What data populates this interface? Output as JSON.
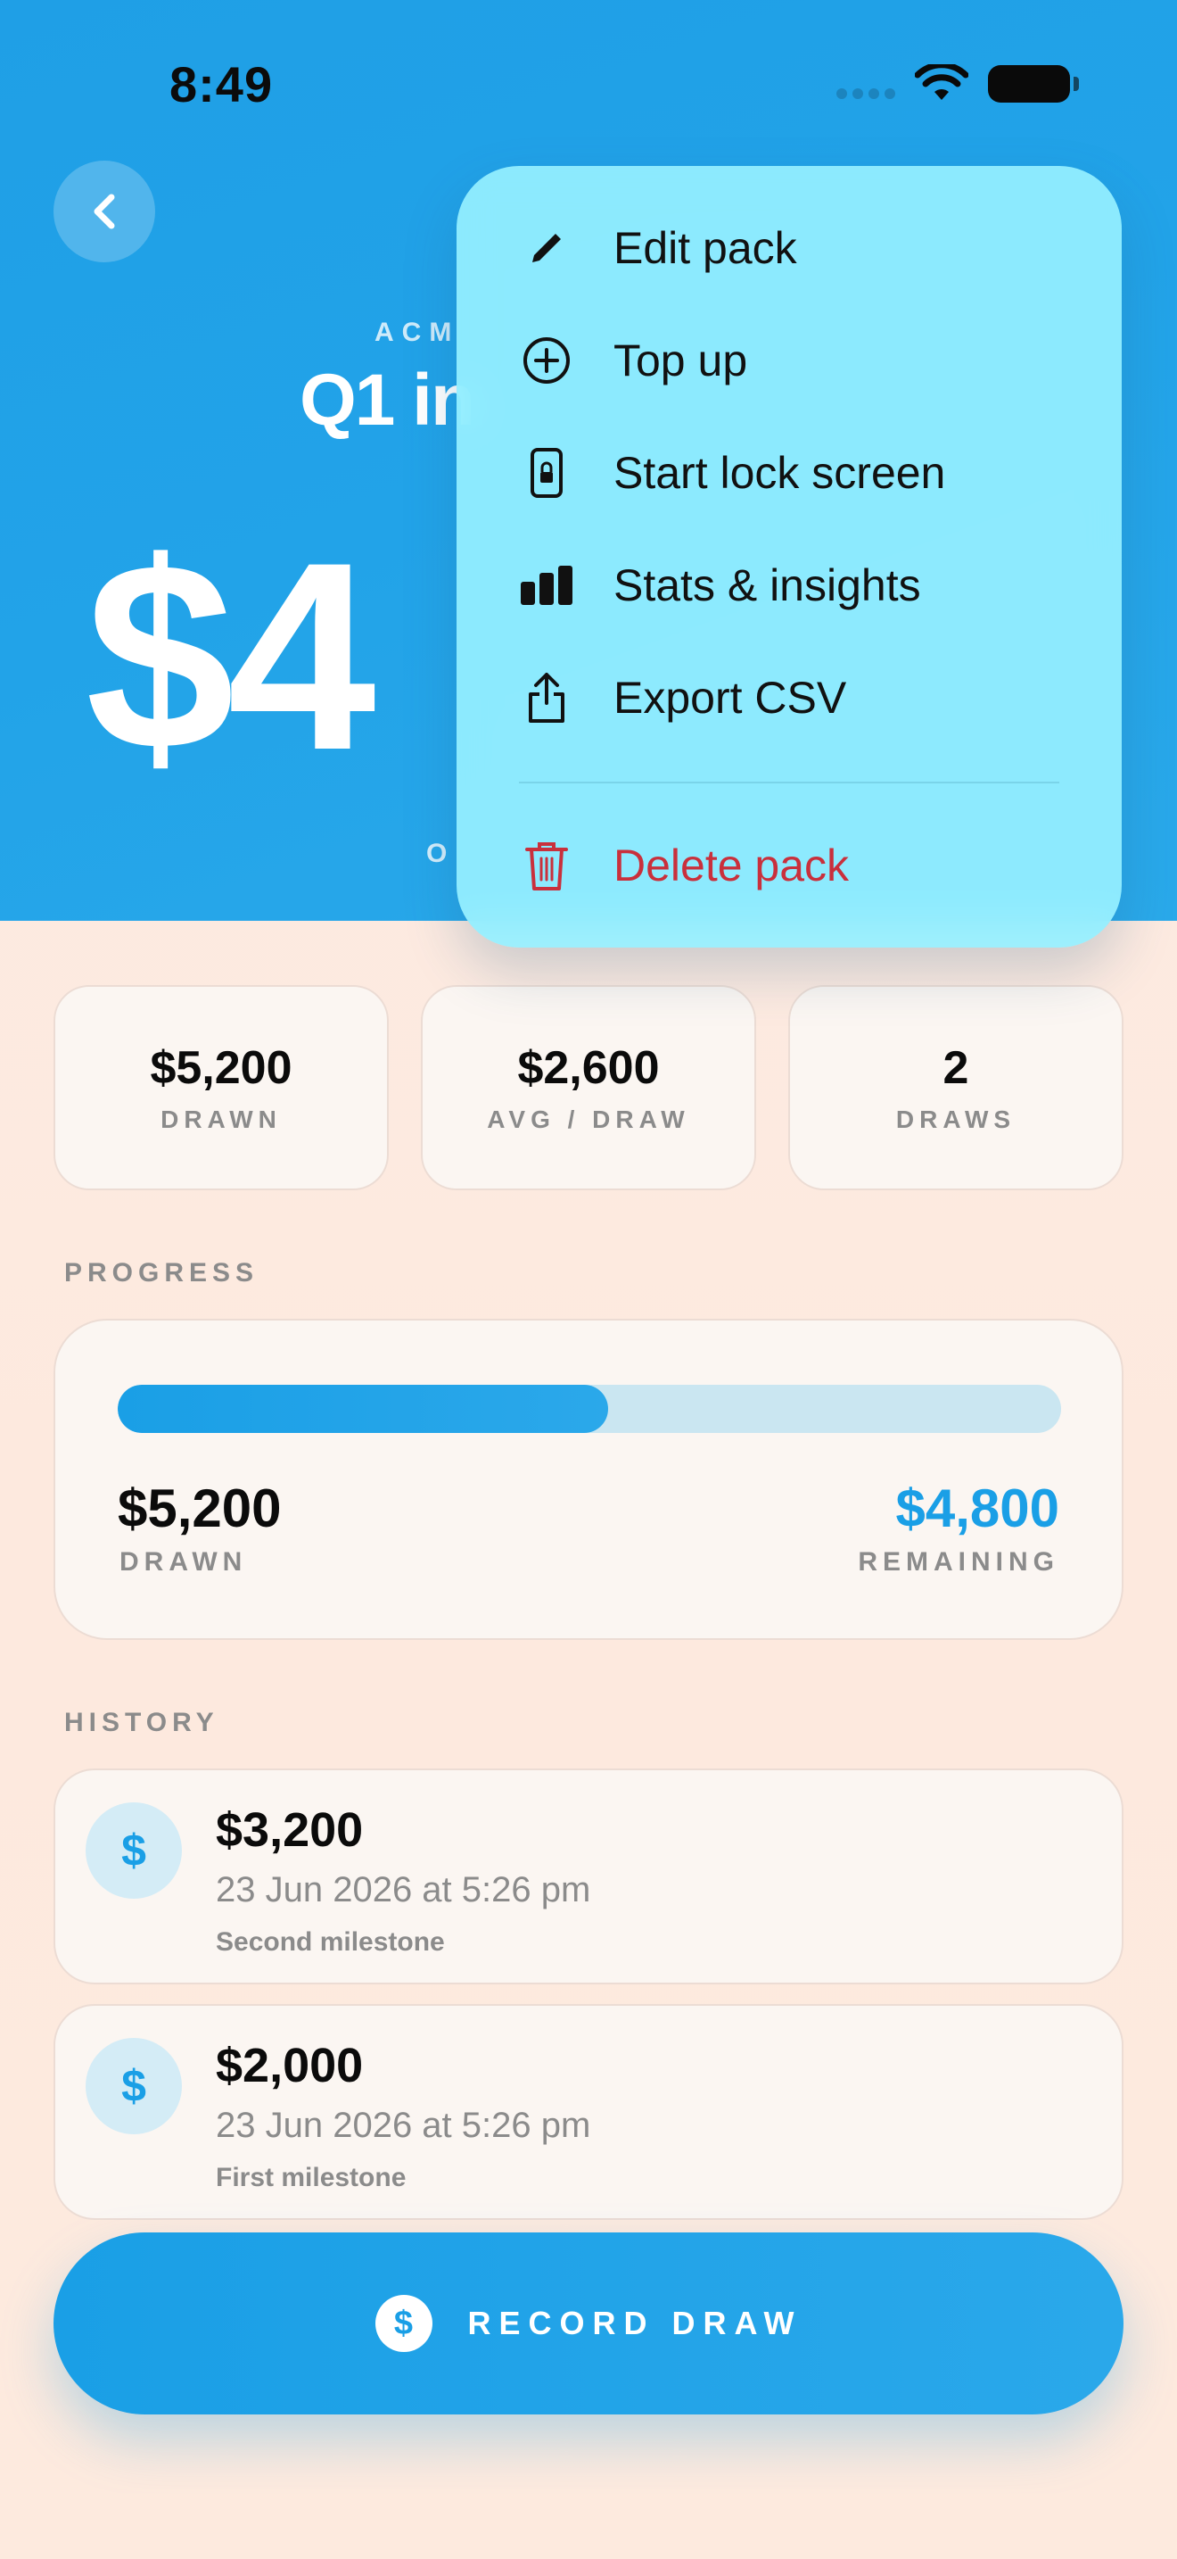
{
  "status_bar": {
    "time": "8:49"
  },
  "header": {
    "company": "ACM",
    "title": "Q1 in",
    "amount": "$4",
    "subtitle": "O"
  },
  "menu": {
    "items": [
      {
        "label": "Edit pack",
        "icon": "pencil-icon"
      },
      {
        "label": "Top up",
        "icon": "plus-circle-icon"
      },
      {
        "label": "Start lock screen",
        "icon": "lock-screen-icon"
      },
      {
        "label": "Stats & insights",
        "icon": "bar-chart-icon"
      },
      {
        "label": "Export CSV",
        "icon": "share-icon"
      }
    ],
    "delete": {
      "label": "Delete pack",
      "icon": "trash-icon"
    }
  },
  "stats": [
    {
      "value": "$5,200",
      "label": "DRAWN"
    },
    {
      "value": "$2,600",
      "label": "AVG / DRAW"
    },
    {
      "value": "2",
      "label": "DRAWS"
    }
  ],
  "progress": {
    "section_label": "PROGRESS",
    "drawn_value": "$5,200",
    "drawn_label": "DRAWN",
    "remaining_value": "$4,800",
    "remaining_label": "REMAINING",
    "fraction_drawn": 0.52
  },
  "history": {
    "section_label": "HISTORY",
    "entries": [
      {
        "icon": "$",
        "amount": "$3,200",
        "date": "23 Jun 2026 at 5:26 pm",
        "note": "Second milestone"
      },
      {
        "icon": "$",
        "amount": "$2,000",
        "date": "23 Jun 2026 at 5:26 pm",
        "note": "First milestone"
      }
    ]
  },
  "record_button": {
    "icon": "$",
    "label": "RECORD DRAW"
  },
  "colors": {
    "accent": "#1a9fe6",
    "danger": "#c9303c",
    "menu": "#96f0ff"
  }
}
